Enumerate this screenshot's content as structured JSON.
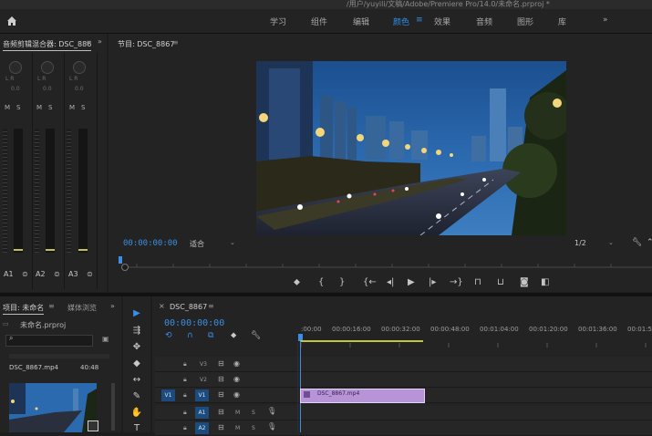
{
  "window": {
    "title": "/用户/yuyili/文稿/Adobe/Premiere Pro/14.0/未命名.prproj *"
  },
  "workspaces": {
    "items": [
      "学习",
      "组件",
      "编辑",
      "颜色",
      "效果",
      "音频",
      "图形",
      "库"
    ],
    "active": "颜色",
    "menu_glyph": "≡"
  },
  "mixer": {
    "title": "音频剪辑混合器: DSC_886",
    "lr_label": "L    R",
    "zero": "0.0",
    "mute": "M",
    "solo": "S",
    "channels": [
      "A1",
      "A2",
      "A3"
    ]
  },
  "program": {
    "title": "节目: DSC_8867",
    "menu_glyph": "≡",
    "timecode": "00:00:00:00",
    "fit": "适合",
    "resolution": "1/2"
  },
  "project": {
    "tab_project": "项目: 未命名",
    "tab_media": "媒体浏览",
    "file": "未命名.prproj",
    "clip_name": "DSC_8867.mp4",
    "clip_duration": "40:48"
  },
  "timeline": {
    "tab": "DSC_8867",
    "timecode": "00:00:00:00",
    "ruler": [
      ":00:00",
      "00:00:16:00",
      "00:00:32:00",
      "00:00:48:00",
      "00:01:04:00",
      "00:01:20:00",
      "00:01:36:00",
      "00:01:5"
    ],
    "tracks": [
      {
        "name": "V3",
        "type": "video"
      },
      {
        "name": "V2",
        "type": "video"
      },
      {
        "name": "V1",
        "type": "video",
        "target": "V1"
      },
      {
        "name": "A1",
        "type": "audio",
        "target": "A1"
      },
      {
        "name": "A2",
        "type": "audio",
        "target": "A2"
      }
    ],
    "clip_label": "DSC_8867.mp4",
    "mute": "M",
    "solo": "S"
  },
  "colors": {
    "accent": "#2e8ee8",
    "clip": "#b794d8",
    "playhead": "#3b8ee8"
  }
}
